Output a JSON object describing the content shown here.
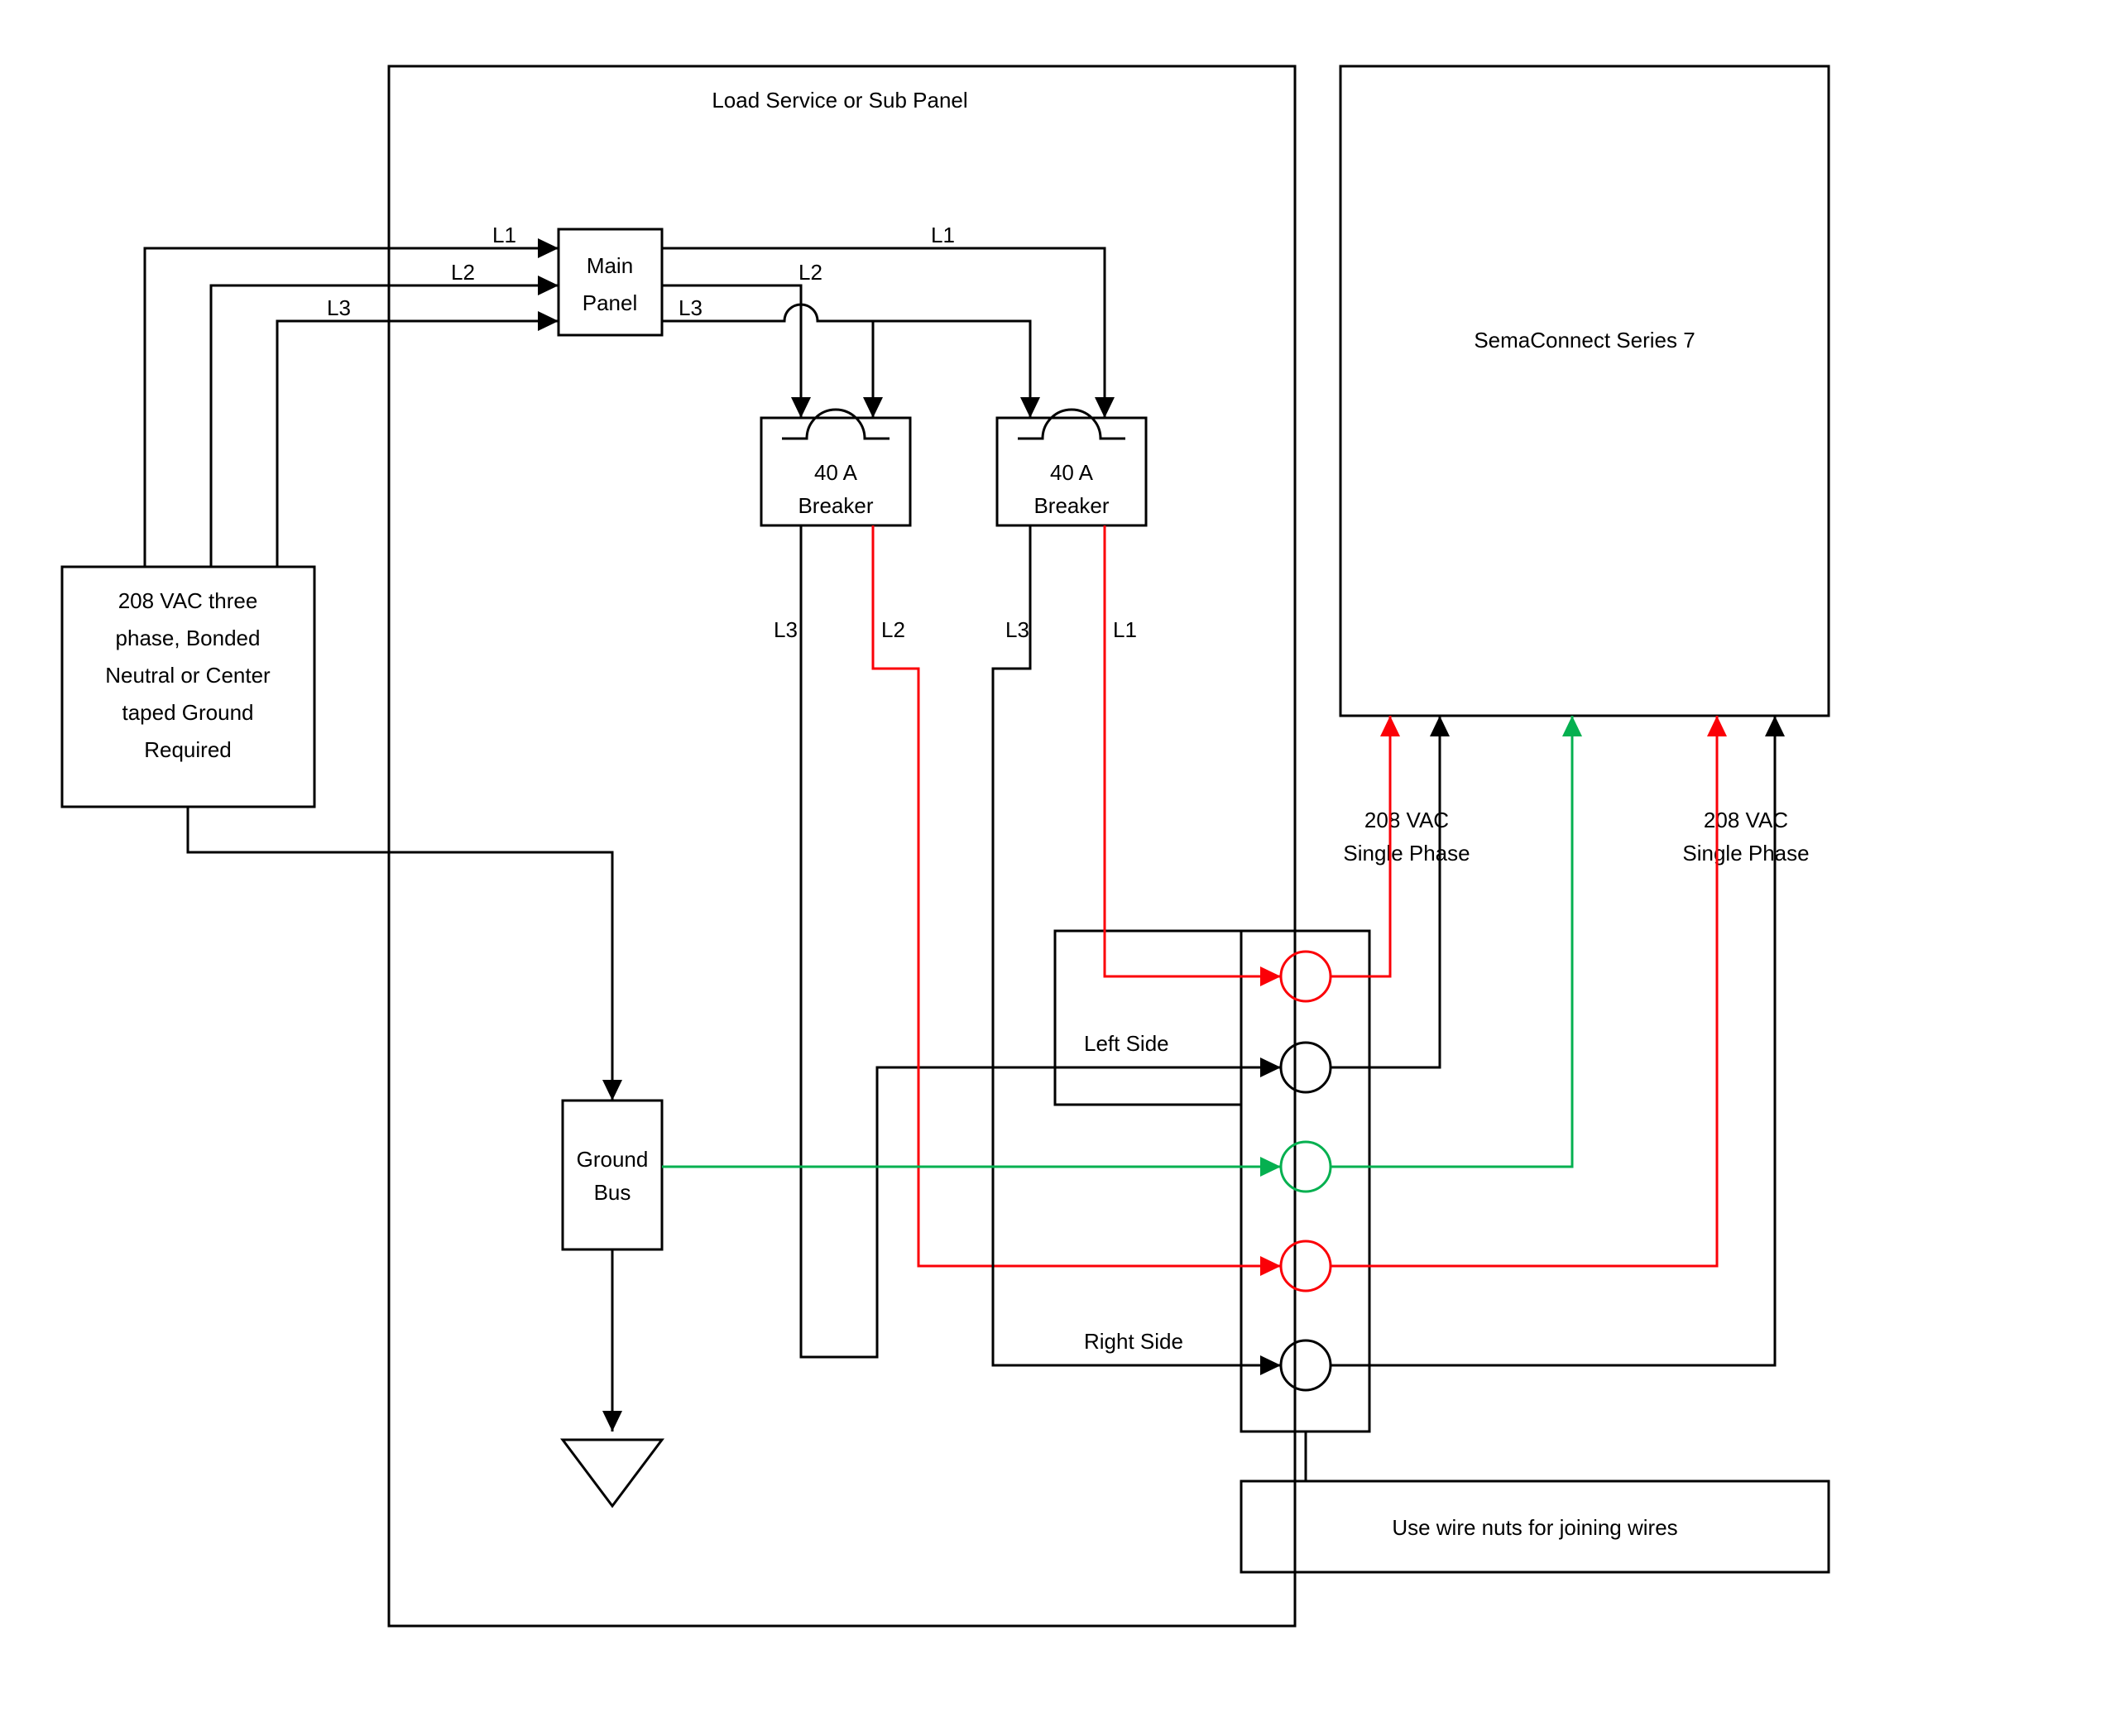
{
  "panel_title": "Load Service or Sub Panel",
  "source_box": {
    "l1": "208 VAC three",
    "l2": "phase, Bonded",
    "l3": "Neutral or Center",
    "l4": "taped Ground",
    "l5": "Required"
  },
  "main_panel": {
    "l1": "Main",
    "l2": "Panel"
  },
  "phase_labels": {
    "L1_in": "L1",
    "L2_in": "L2",
    "L3_in": "L3",
    "L1_out": "L1",
    "L2_out": "L2",
    "L3_out": "L3"
  },
  "breaker_a": {
    "l1": "40 A",
    "l2": "Breaker",
    "out_left": "L3",
    "out_right": "L2"
  },
  "breaker_b": {
    "l1": "40 A",
    "l2": "Breaker",
    "out_left": "L3",
    "out_right": "L1"
  },
  "ground_bus": {
    "l1": "Ground",
    "l2": "Bus"
  },
  "device": "SemaConnect Series 7",
  "left_side": "Left Side",
  "right_side": "Right Side",
  "phase_label_a": {
    "l1": "208 VAC",
    "l2": "Single Phase"
  },
  "phase_label_b": {
    "l1": "208 VAC",
    "l2": "Single Phase"
  },
  "wire_nuts": "Use wire nuts for joining wires",
  "colors": {
    "black": "#000000",
    "red": "#fb0007",
    "green": "#05b050"
  }
}
